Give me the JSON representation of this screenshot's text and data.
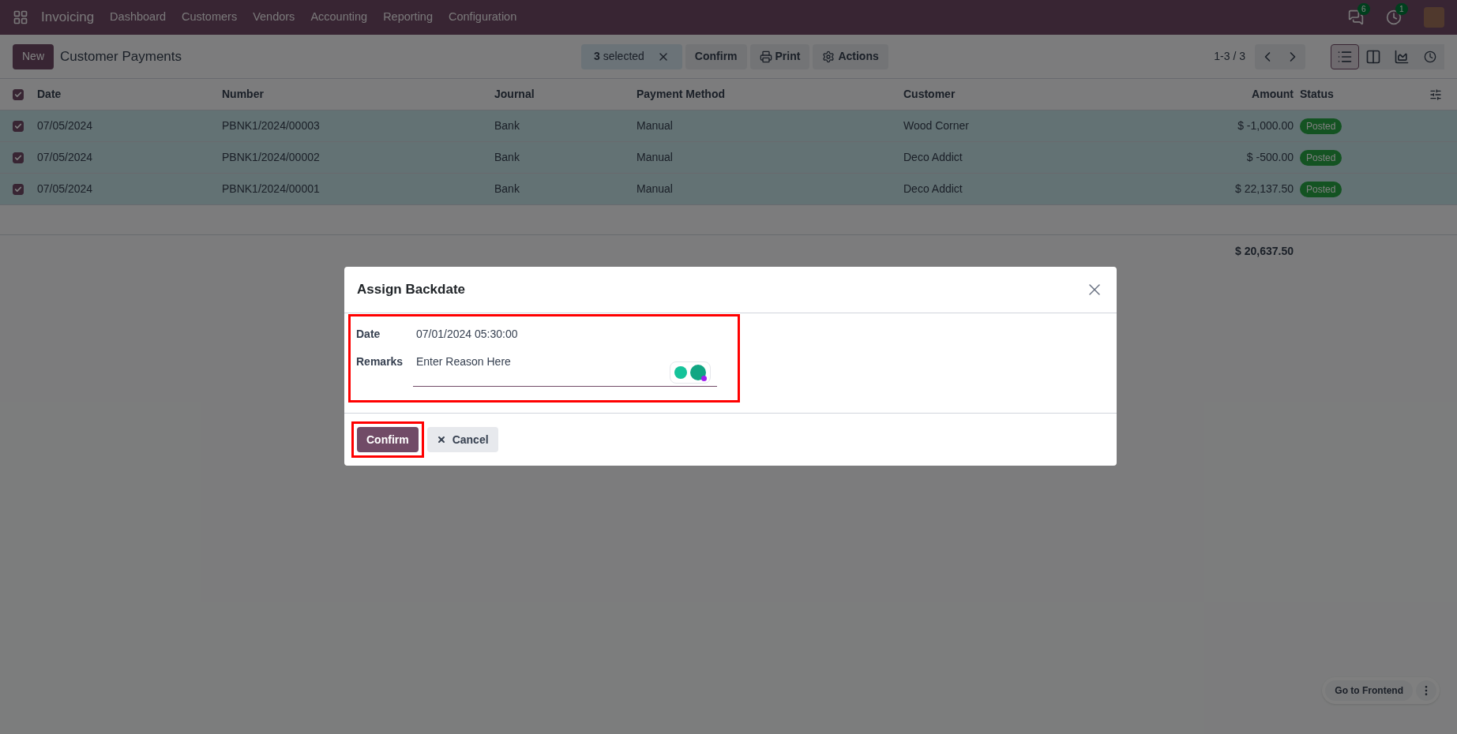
{
  "navbar": {
    "app_name": "Invoicing",
    "menu": [
      "Dashboard",
      "Customers",
      "Vendors",
      "Accounting",
      "Reporting",
      "Configuration"
    ],
    "messages_badge": "6",
    "activity_badge": "1"
  },
  "control_panel": {
    "new_button": "New",
    "title": "Customer Payments",
    "selection": {
      "count": "3",
      "label": "selected"
    },
    "actions": [
      {
        "label": "Confirm",
        "kind": "plain"
      },
      {
        "label": "Print",
        "kind": "print"
      },
      {
        "label": "Actions",
        "kind": "gear"
      }
    ],
    "pager": "1-3 / 3",
    "views": [
      {
        "kind": "list",
        "selected": true
      },
      {
        "kind": "kanban",
        "selected": false
      },
      {
        "kind": "graph",
        "selected": false
      },
      {
        "kind": "activity",
        "selected": false
      }
    ]
  },
  "table": {
    "all_selected": true,
    "columns": [
      "Date",
      "Number",
      "Journal",
      "Payment Method",
      "Customer",
      "Amount",
      "Status"
    ],
    "rows": [
      {
        "selected": true,
        "cells": [
          "07/05/2024",
          "PBNK1/2024/00003",
          "Bank",
          "Manual",
          "Wood Corner",
          "$ -1,000.00"
        ],
        "status": "Posted"
      },
      {
        "selected": true,
        "cells": [
          "07/05/2024",
          "PBNK1/2024/00002",
          "Bank",
          "Manual",
          "Deco Addict",
          "$ -500.00"
        ],
        "status": "Posted"
      },
      {
        "selected": true,
        "cells": [
          "07/05/2024",
          "PBNK1/2024/00001",
          "Bank",
          "Manual",
          "Deco Addict",
          "$ 22,137.50"
        ],
        "status": "Posted"
      }
    ],
    "total": "$ 20,637.50"
  },
  "dialog": {
    "title": "Assign Backdate",
    "fields": [
      {
        "label": "Date",
        "kind": "value",
        "value": "07/01/2024 05:30:00"
      },
      {
        "label": "Remarks",
        "kind": "textarea",
        "placeholder": "Enter Reason Here"
      }
    ],
    "confirm_button": "Confirm",
    "cancel_button": "Cancel"
  },
  "frontend_button": "Go to Frontend"
}
